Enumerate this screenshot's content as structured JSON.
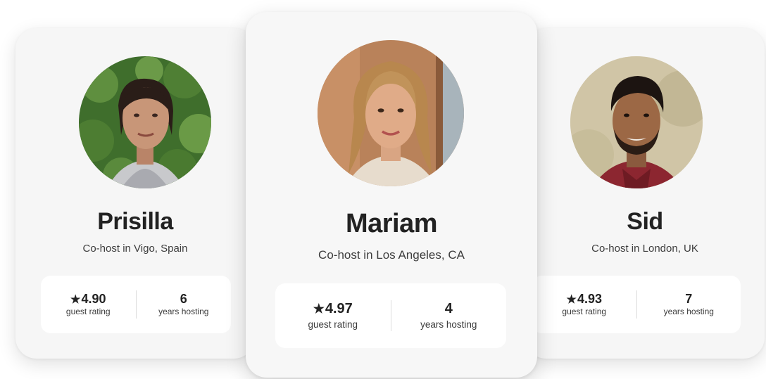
{
  "hosts": [
    {
      "name": "Prisilla",
      "subtitle": "Co-host in Vigo, Spain",
      "rating": "4.90",
      "rating_label": "guest rating",
      "years": "6",
      "years_label": "years hosting"
    },
    {
      "name": "Mariam",
      "subtitle": "Co-host in Los Angeles, CA",
      "rating": "4.97",
      "rating_label": "guest rating",
      "years": "4",
      "years_label": "years hosting"
    },
    {
      "name": "Sid",
      "subtitle": "Co-host in London, UK",
      "rating": "4.93",
      "rating_label": "guest rating",
      "years": "7",
      "years_label": "years hosting"
    }
  ],
  "icons": {
    "star": "star-icon"
  },
  "colors": {
    "card_background": "#f6f6f6",
    "stats_background": "#ffffff",
    "text_primary": "#222222",
    "text_secondary": "#3d3d3d"
  }
}
